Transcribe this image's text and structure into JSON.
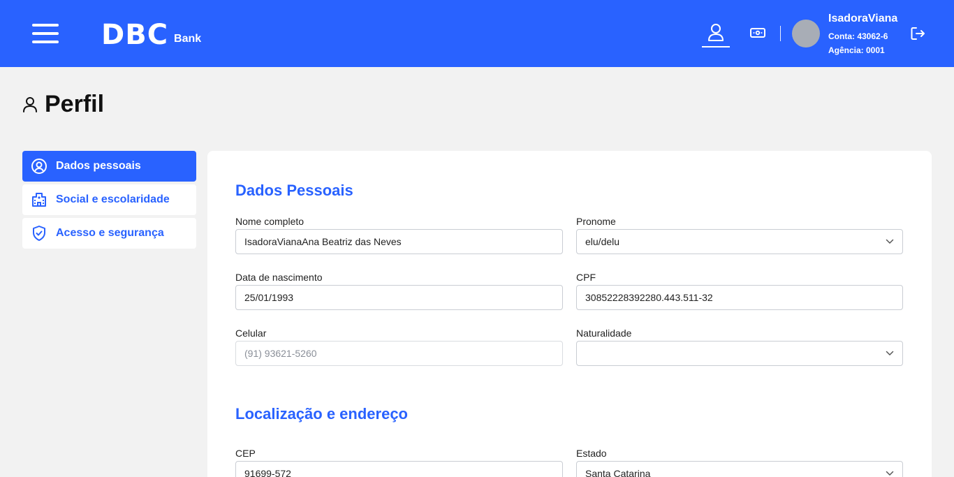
{
  "header": {
    "logo_main": "DBC",
    "logo_sub": "Bank",
    "user_name": "IsadoraViana",
    "account": "Conta: 43062-6",
    "agency": "Agência: 0001"
  },
  "page": {
    "title": "Perfil"
  },
  "sidebar": {
    "items": [
      {
        "label": "Dados pessoais",
        "icon": "user-circle-icon",
        "active": true
      },
      {
        "label": "Social e escolaridade",
        "icon": "building-icon",
        "active": false
      },
      {
        "label": "Acesso e segurança",
        "icon": "shield-check-icon",
        "active": false
      }
    ]
  },
  "form": {
    "personal_title": "Dados Pessoais",
    "full_name": {
      "label": "Nome completo",
      "value": "IsadoraVianaAna Beatriz das Neves"
    },
    "pronoun": {
      "label": "Pronome",
      "value": "elu/delu"
    },
    "birth_date": {
      "label": "Data de nascimento",
      "value": "25/01/1993"
    },
    "cpf": {
      "label": "CPF",
      "value": "30852228392280.443.511-32"
    },
    "phone": {
      "label": "Celular",
      "value": "(91) 93621-5260"
    },
    "birthplace": {
      "label": "Naturalidade",
      "value": ""
    },
    "location_title": "Localização e endereço",
    "cep": {
      "label": "CEP",
      "value": "91699-572"
    },
    "state": {
      "label": "Estado",
      "value": "Santa Catarina"
    }
  },
  "colors": {
    "primary": "#2962ff",
    "background": "#f2f2f2"
  }
}
